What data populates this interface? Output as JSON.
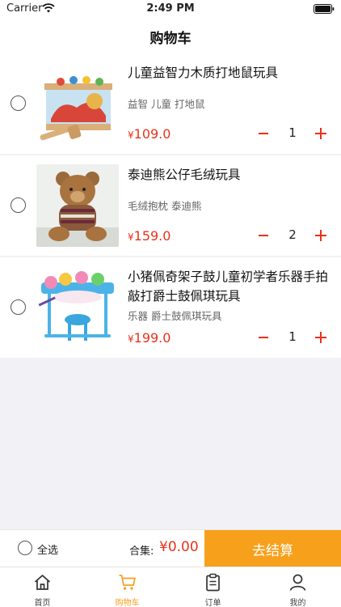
{
  "status_bar": {
    "carrier": "Carrier",
    "time": "2:49 PM"
  },
  "nav": {
    "title": "购物车"
  },
  "cart": {
    "items": [
      {
        "title": "儿童益智力木质打地鼠玩具",
        "tags": "益智 儿童 打地鼠",
        "price": "109.0",
        "qty": "1",
        "image": "whack-a-mole-toy-image"
      },
      {
        "title": "泰迪熊公仔毛绒玩具",
        "tags": "毛绒抱枕 泰迪熊",
        "price": "159.0",
        "qty": "2",
        "image": "teddy-bear-image"
      },
      {
        "title": "小猪佩奇架子鼓儿童初学者乐器手拍敲打爵士鼓佩琪玩具",
        "tags": "乐器 爵士鼓佩琪玩具",
        "price": "199.0",
        "qty": "1",
        "image": "drum-set-image"
      }
    ],
    "currency_symbol": "¥"
  },
  "checkout": {
    "select_all_label": "全选",
    "total_label": "合集:",
    "total_value": "¥0.00",
    "checkout_label": "去结算"
  },
  "tabs": [
    {
      "label": "首页",
      "icon": "home-icon"
    },
    {
      "label": "购物车",
      "icon": "cart-icon",
      "active": true
    },
    {
      "label": "订单",
      "icon": "order-icon"
    },
    {
      "label": "我的",
      "icon": "profile-icon"
    }
  ],
  "colors": {
    "accent": "#f5a023",
    "price": "#e8321c",
    "checkout": "#f7a01c",
    "background": "#f2f2f6"
  }
}
